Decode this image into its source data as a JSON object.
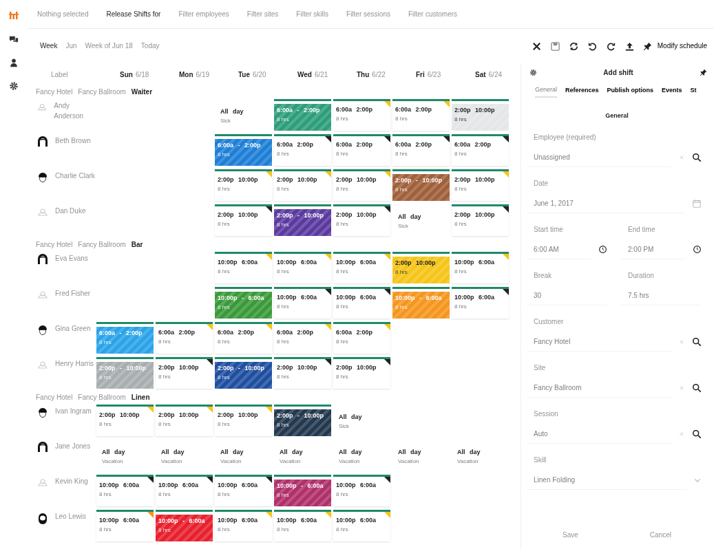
{
  "top_bar": {
    "selector": "Nothing selected",
    "items": [
      {
        "label": "Release Shifts for",
        "active": true
      },
      {
        "label": "Filter employees",
        "active": false
      },
      {
        "label": "Filter sites",
        "active": false
      },
      {
        "label": "Filter skills",
        "active": false
      },
      {
        "label": "Filter sessions",
        "active": false
      },
      {
        "label": "Filter customers",
        "active": false
      }
    ]
  },
  "toolbar": {
    "view_buttons": [
      "Week",
      "Jun",
      "Week of Jun 18",
      "Today"
    ],
    "modify_label": "Modify schedule"
  },
  "header": {
    "label": "Label",
    "days": [
      {
        "name": "Sun",
        "date": "6/18"
      },
      {
        "name": "Mon",
        "date": "6/19"
      },
      {
        "name": "Tue",
        "date": "6/20"
      },
      {
        "name": "Wed",
        "date": "6/21"
      },
      {
        "name": "Thu",
        "date": "6/22"
      },
      {
        "name": "Fri",
        "date": "6/23"
      },
      {
        "name": "Sat",
        "date": "6/24"
      }
    ]
  },
  "groups": [
    {
      "path": [
        "Fancy Hotel",
        "Fancy Ballroom"
      ],
      "skill": "Waiter",
      "employees": [
        {
          "name": "Andy Anderson",
          "avatar": {
            "kind": "faint"
          },
          "shifts": [
            {
              "kind": "empty"
            },
            {
              "kind": "empty"
            },
            {
              "kind": "allday",
              "time": "All day",
              "note": "Sick"
            },
            {
              "kind": "filled",
              "time": "6:00a - 2:00p",
              "note": "8 hrs",
              "color": "#2e9e7a"
            },
            {
              "kind": "plain",
              "time": "6:00a 2:00p",
              "note": "8 hrs",
              "flag": {
                "color": "#f5c518"
              }
            },
            {
              "kind": "plain",
              "time": "6:00a 2:00p",
              "note": "8 hrs",
              "flag": {
                "color": "#f5c518"
              }
            },
            {
              "kind": "filled",
              "time": "2:00p 10:00p",
              "note": "8 hrs",
              "color": "#e4e6e8"
            }
          ]
        },
        {
          "name": "Beth Brown",
          "avatar": {
            "kind": "woman"
          },
          "shifts": [
            {
              "kind": "empty"
            },
            {
              "kind": "empty"
            },
            {
              "kind": "filled",
              "time": "6:00a - 2:00p",
              "note": "8 hrs",
              "color": "#1e7fd6"
            },
            {
              "kind": "plain",
              "time": "6:00a 2:00p",
              "note": "8 hrs",
              "flag": {
                "color": "#222222"
              }
            },
            {
              "kind": "plain",
              "time": "6:00a 2:00p",
              "note": "8 hrs",
              "flag": {
                "color": "#222222"
              }
            },
            {
              "kind": "plain",
              "time": "6:00a 2:00p",
              "note": "8 hrs",
              "flag": {
                "color": "#222222"
              }
            },
            {
              "kind": "plain",
              "time": "6:00a 2:00p",
              "note": "8 hrs",
              "flag": {
                "color": "#222222"
              }
            }
          ]
        },
        {
          "name": "Charlie Clark",
          "avatar": {
            "kind": "man"
          },
          "shifts": [
            {
              "kind": "empty"
            },
            {
              "kind": "empty"
            },
            {
              "kind": "plain",
              "time": "2:00p 10:00p",
              "note": "8 hrs",
              "flag": {
                "color": "#f5c518"
              }
            },
            {
              "kind": "plain",
              "time": "2:00p 10:00p",
              "note": "8 hrs",
              "flag": {
                "color": "#f5c518"
              }
            },
            {
              "kind": "plain",
              "time": "2:00p 10:00p",
              "note": "8 hrs",
              "flag": {
                "color": "#f5c518"
              }
            },
            {
              "kind": "filled",
              "time": "2:00p - 10:00p",
              "note": "8 hrs",
              "color": "#a0603a"
            },
            {
              "kind": "plain",
              "time": "2:00p 10:00p",
              "note": "8 hrs",
              "flag": {
                "color": "#f5c518"
              }
            }
          ]
        },
        {
          "name": "Dan Duke",
          "avatar": {
            "kind": "faint"
          },
          "shifts": [
            {
              "kind": "empty"
            },
            {
              "kind": "empty"
            },
            {
              "kind": "plain",
              "time": "2:00p 10:00p",
              "note": "8 hrs",
              "flag": {
                "color": "#222222"
              }
            },
            {
              "kind": "filled",
              "time": "2:00p - 10:00p",
              "note": "8 hrs",
              "color": "#5b3aa0"
            },
            {
              "kind": "plain",
              "time": "2:00p 10:00p",
              "note": "8 hrs",
              "flag": {
                "color": "#222222"
              }
            },
            {
              "kind": "allday",
              "time": "All day",
              "note": "Sick"
            },
            {
              "kind": "plain",
              "time": "2:00p 10:00p",
              "note": "8 hrs",
              "flag": {
                "color": "#222222"
              }
            }
          ]
        }
      ]
    },
    {
      "path": [
        "Fancy Hotel",
        "Fancy Ballroom"
      ],
      "skill": "Bar",
      "employees": [
        {
          "name": "Eva Evans",
          "avatar": {
            "kind": "woman"
          },
          "shifts": [
            {
              "kind": "empty"
            },
            {
              "kind": "empty"
            },
            {
              "kind": "plain",
              "time": "10:00p 6:00a",
              "note": "8 hrs",
              "flag": {
                "color": "#f5c518"
              }
            },
            {
              "kind": "plain",
              "time": "10:00p 6:00a",
              "note": "8 hrs",
              "flag": {
                "color": "#f5c518"
              }
            },
            {
              "kind": "plain",
              "time": "10:00p 6:00a",
              "note": "8 hrs",
              "flag": {
                "color": "#f5c518"
              }
            },
            {
              "kind": "filled",
              "time": "2:00p 10:00p",
              "note": "8 hrs",
              "color": "#f5c518"
            },
            {
              "kind": "plain",
              "time": "10:00p 6:00a",
              "note": "8 hrs",
              "flag": {
                "color": "#f5c518"
              }
            }
          ]
        },
        {
          "name": "Fred Fisher",
          "avatar": {
            "kind": "faint"
          },
          "shifts": [
            {
              "kind": "empty"
            },
            {
              "kind": "empty"
            },
            {
              "kind": "filled",
              "time": "10:00p - 6:00a",
              "note": "8 hrs",
              "color": "#3a9a3a"
            },
            {
              "kind": "plain",
              "time": "10:00p 6:00a",
              "note": "8 hrs",
              "flag": {
                "color": "#222222"
              }
            },
            {
              "kind": "plain",
              "time": "10:00p 6:00a",
              "note": "8 hrs",
              "flag": {
                "color": "#222222"
              }
            },
            {
              "kind": "filled",
              "time": "10:00p - 6:00a",
              "note": "8 hrs",
              "color": "#f5961e"
            },
            {
              "kind": "plain",
              "time": "10:00p 6:00a",
              "note": "8 hrs",
              "flag": {
                "color": "#222222"
              }
            }
          ]
        },
        {
          "name": "Gina Green",
          "avatar": {
            "kind": "man"
          },
          "shifts": [
            {
              "kind": "filled",
              "time": "6:00a - 2:00p",
              "note": "8 hrs",
              "color": "#2aa3e8"
            },
            {
              "kind": "plain",
              "time": "6:00a 2:00p",
              "note": "8 hrs",
              "flag": {
                "color": "#f5c518"
              }
            },
            {
              "kind": "plain",
              "time": "6:00a 2:00p",
              "note": "8 hrs",
              "flag": {
                "color": "#f5c518"
              }
            },
            {
              "kind": "plain",
              "time": "6:00a 2:00p",
              "note": "8 hrs",
              "flag": {
                "color": "#f5c518"
              }
            },
            {
              "kind": "plain",
              "time": "6:00a 2:00p",
              "note": "8 hrs",
              "flag": {
                "color": "#f5c518"
              }
            },
            {
              "kind": "empty"
            },
            {
              "kind": "empty"
            }
          ]
        },
        {
          "name": "Henry Harris",
          "avatar": {
            "kind": "faint"
          },
          "shifts": [
            {
              "kind": "filled",
              "time": "2:00p - 10:00p",
              "note": "8 hrs",
              "color": "#a8aeb0"
            },
            {
              "kind": "plain",
              "time": "2:00p 10:00p",
              "note": "8 hrs",
              "flag": {
                "color": "#222222"
              }
            },
            {
              "kind": "filled",
              "time": "2:00p - 10:00p",
              "note": "8 hrs",
              "color": "#1f4fa0"
            },
            {
              "kind": "plain",
              "time": "2:00p 10:00p",
              "note": "8 hrs",
              "flag": {
                "color": "#222222"
              }
            },
            {
              "kind": "plain",
              "time": "2:00p 10:00p",
              "note": "8 hrs",
              "flag": {
                "color": "#222222"
              }
            },
            {
              "kind": "empty"
            },
            {
              "kind": "empty"
            }
          ]
        }
      ]
    },
    {
      "path": [
        "Fancy Hotel",
        "Fancy Ballroom"
      ],
      "skill": "Linen",
      "employees": [
        {
          "name": "Ivan Ingram",
          "avatar": {
            "kind": "man"
          },
          "shifts": [
            {
              "kind": "plain",
              "time": "2:00p 10:00p",
              "note": "8 hrs",
              "flag": {
                "color": "#f5c518"
              }
            },
            {
              "kind": "plain",
              "time": "2:00p 10:00p",
              "note": "8 hrs",
              "flag": {
                "color": "#f5c518"
              }
            },
            {
              "kind": "plain",
              "time": "2:00p 10:00p",
              "note": "8 hrs",
              "flag": {
                "color": "#f5c518"
              }
            },
            {
              "kind": "filled",
              "time": "2:00p - 10:00p",
              "note": "8 hrs",
              "color": "#24384f"
            },
            {
              "kind": "allday",
              "time": "All day",
              "note": "Sick"
            },
            {
              "kind": "empty"
            },
            {
              "kind": "empty"
            }
          ]
        },
        {
          "name": "Jane Jones",
          "avatar": {
            "kind": "woman"
          },
          "shifts": [
            {
              "kind": "allday",
              "time": "All day",
              "note": "Vacation"
            },
            {
              "kind": "allday",
              "time": "All day",
              "note": "Vacation"
            },
            {
              "kind": "allday",
              "time": "All day",
              "note": "Vacation"
            },
            {
              "kind": "allday",
              "time": "All day",
              "note": "Vacation"
            },
            {
              "kind": "allday",
              "time": "All day",
              "note": "Vacation"
            },
            {
              "kind": "allday",
              "time": "All day",
              "note": "Vacation"
            },
            {
              "kind": "allday",
              "time": "All day",
              "note": "Vacation"
            }
          ]
        },
        {
          "name": "Kevin King",
          "avatar": {
            "kind": "faint"
          },
          "shifts": [
            {
              "kind": "plain",
              "time": "10:00p 6:00a",
              "note": "8 hrs",
              "flag": {
                "color": "#222222"
              }
            },
            {
              "kind": "plain",
              "time": "10:00p 6:00a",
              "note": "8 hrs",
              "flag": {
                "color": "#222222"
              }
            },
            {
              "kind": "plain",
              "time": "10:00p 6:00a",
              "note": "8 hrs",
              "flag": {
                "color": "#222222"
              }
            },
            {
              "kind": "filled",
              "time": "10:00p - 6:00a",
              "note": "8 hrs",
              "color": "#b0306a"
            },
            {
              "kind": "plain",
              "time": "10:00p 6:00a",
              "note": "8 hrs",
              "flag": {
                "color": "#222222"
              }
            },
            {
              "kind": "empty"
            },
            {
              "kind": "empty"
            }
          ]
        },
        {
          "name": "Leo Lewis",
          "avatar": {
            "kind": "beard"
          },
          "shifts": [
            {
              "kind": "plain",
              "time": "10:00p 6:00a",
              "note": "8 hrs",
              "flag": {
                "color": "#f5961e"
              }
            },
            {
              "kind": "filled",
              "time": "10:00p - 6:00a",
              "note": "8 hrs",
              "color": "#e8202e"
            },
            {
              "kind": "plain",
              "time": "10:00p 6:00a",
              "note": "8 hrs",
              "flag": {
                "color": "#f5c518"
              }
            },
            {
              "kind": "plain",
              "time": "10:00p 6:00a",
              "note": "8 hrs",
              "flag": {
                "color": "#f5c518"
              }
            },
            {
              "kind": "plain",
              "time": "10:00p 6:00a",
              "note": "8 hrs",
              "flag": {
                "color": "#f5c518"
              }
            },
            {
              "kind": "empty"
            },
            {
              "kind": "empty"
            }
          ]
        }
      ]
    }
  ],
  "panel": {
    "title": "Add shift",
    "tabs": [
      {
        "label": "General",
        "selected": true
      },
      {
        "label": "References",
        "selected": false
      },
      {
        "label": "Publish options",
        "selected": false
      },
      {
        "label": "Events",
        "selected": false
      },
      {
        "label": "St",
        "selected": false
      }
    ],
    "section": "General",
    "fields": [
      {
        "kind": "search",
        "label": "Employee (required)",
        "value": "Unassigned"
      },
      {
        "kind": "date",
        "label": "Date",
        "value": "June 1, 2017"
      },
      {
        "kind": "time_pair",
        "items": [
          {
            "label": "Start time",
            "value": "6:00 AM"
          },
          {
            "label": "End time",
            "value": "2:00 PM"
          }
        ]
      },
      {
        "kind": "text_pair",
        "items": [
          {
            "label": "Break",
            "value": "30"
          },
          {
            "label": "Duration",
            "value": "7.5 hrs"
          }
        ]
      },
      {
        "kind": "search",
        "label": "Customer",
        "value": "Fancy Hotel"
      },
      {
        "kind": "search",
        "label": "Site",
        "value": "Fancy Ballroom"
      },
      {
        "kind": "search",
        "label": "Session",
        "value": "Auto"
      },
      {
        "kind": "select",
        "label": "Skill",
        "value": "Linen Folding"
      }
    ],
    "buttons": [
      "Save",
      "Cancel"
    ]
  }
}
